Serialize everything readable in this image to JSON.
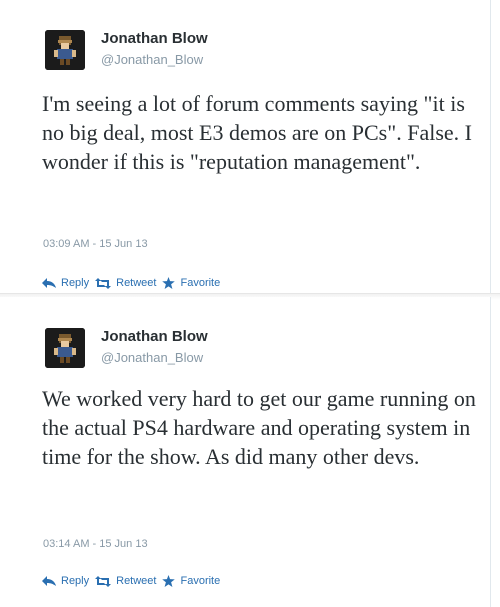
{
  "tweets": [
    {
      "display_name": "Jonathan Blow",
      "handle": "@Jonathan_Blow",
      "text": "I'm seeing a lot of forum comments saying \"it is no big deal, most E3 demos are on PCs\". False. I wonder if this is \"reputation management\".",
      "timestamp": "03:09 AM - 15 Jun 13",
      "actions": {
        "reply": "Reply",
        "retweet": "Retweet",
        "favorite": "Favorite"
      }
    },
    {
      "display_name": "Jonathan Blow",
      "handle": "@Jonathan_Blow",
      "text": "We worked very hard to get our game running on the actual PS4 hardware and operating system in time for the show. As did many other devs.",
      "timestamp": "03:14 AM - 15 Jun 13",
      "actions": {
        "reply": "Reply",
        "retweet": "Retweet",
        "favorite": "Favorite"
      }
    }
  ],
  "colors": {
    "link": "#2a6fb1",
    "muted": "#8899a6",
    "text": "#292f33"
  },
  "icons": [
    "reply-icon",
    "retweet-icon",
    "favorite-icon",
    "avatar"
  ]
}
